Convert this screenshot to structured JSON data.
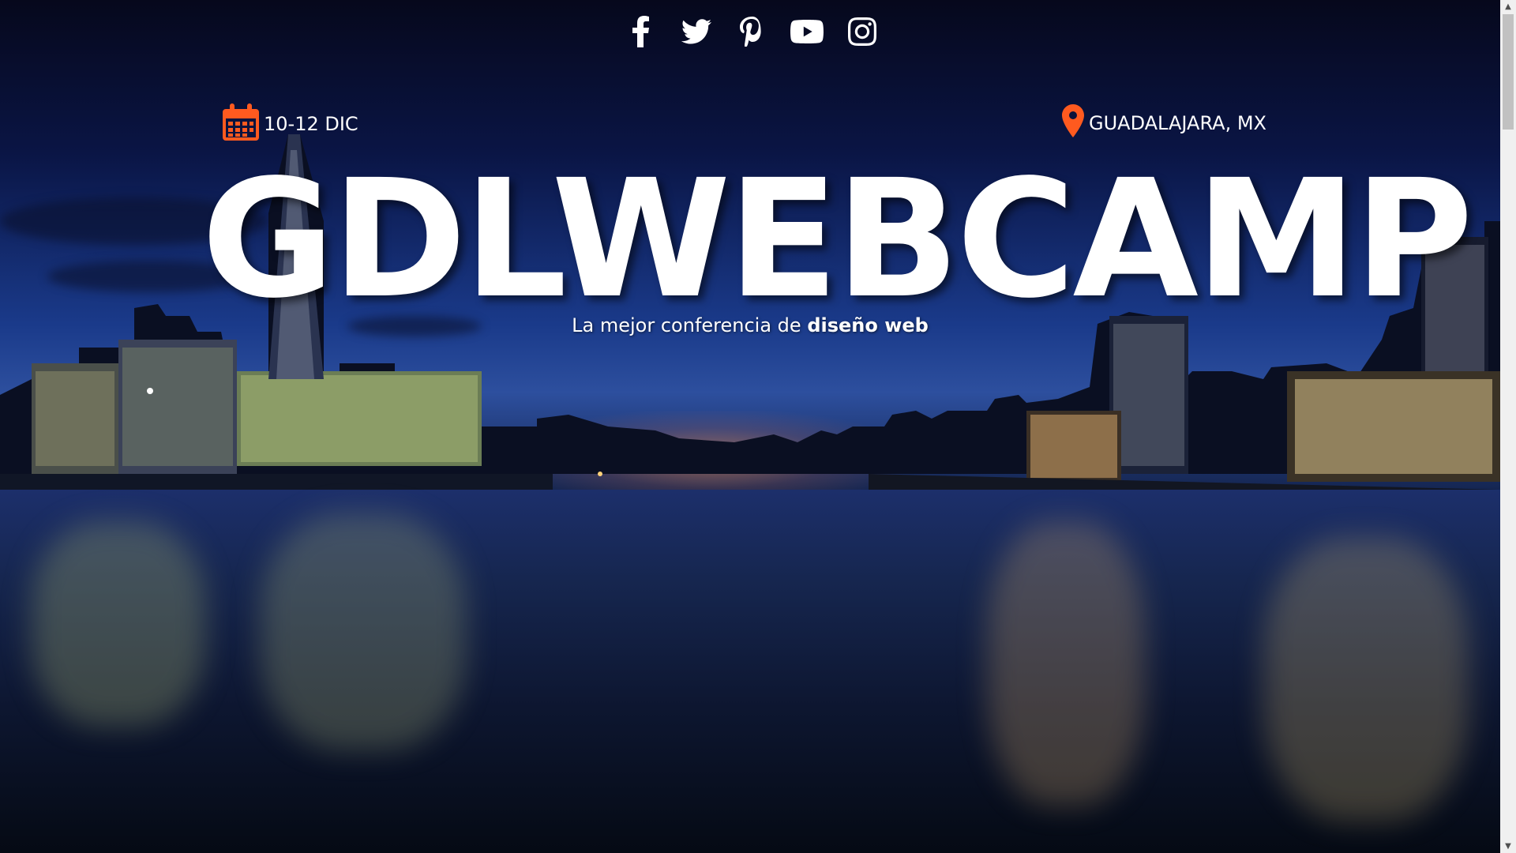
{
  "social": {
    "icons": [
      "facebook-icon",
      "twitter-icon",
      "pinterest-icon",
      "youtube-icon",
      "instagram-icon"
    ]
  },
  "event": {
    "date": "10-12 DIC",
    "location": "GUADALAJARA, MX"
  },
  "hero": {
    "title": "GDLWEBCAMP",
    "subtitle_prefix": "La mejor conferencia de ",
    "subtitle_bold": "diseño web"
  },
  "colors": {
    "accent": "#ff5a1f",
    "text": "#ffffff"
  }
}
